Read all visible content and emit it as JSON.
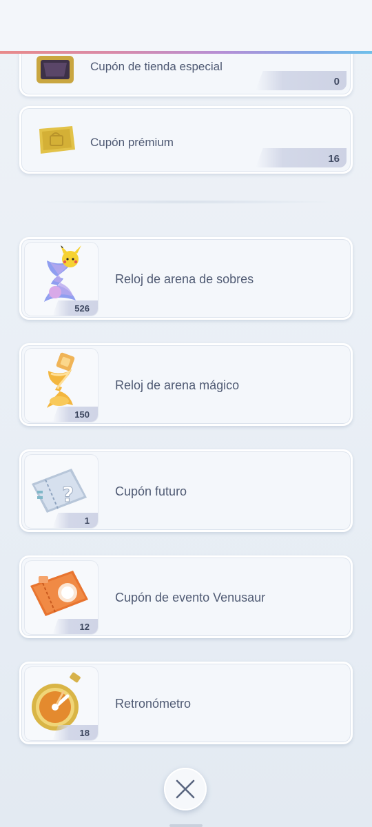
{
  "coupons": [
    {
      "label": "Cupón de tienda especial",
      "count": "0",
      "icon": "special-shop-coupon-icon"
    },
    {
      "label": "Cupón prémium",
      "count": "16",
      "icon": "premium-coupon-icon"
    }
  ],
  "items": [
    {
      "name": "Reloj de arena de sobres",
      "qty": "526",
      "icon": "pack-hourglass-icon"
    },
    {
      "name": "Reloj de arena mágico",
      "qty": "150",
      "icon": "magic-hourglass-icon"
    },
    {
      "name": "Cupón futuro",
      "qty": "1",
      "icon": "future-coupon-icon"
    },
    {
      "name": "Cupón de evento Venusaur",
      "qty": "12",
      "icon": "venusaur-event-coupon-icon"
    },
    {
      "name": "Retronómetro",
      "qty": "18",
      "icon": "stopwatch-icon"
    }
  ],
  "close_button": {
    "icon": "close-icon"
  },
  "colors": {
    "background": "#eaf0f6",
    "card": "#f4f7fb",
    "text": "#4f5a73",
    "accent_gradient_start": "#e88a8a",
    "accent_gradient_end": "#6ec0ea"
  }
}
